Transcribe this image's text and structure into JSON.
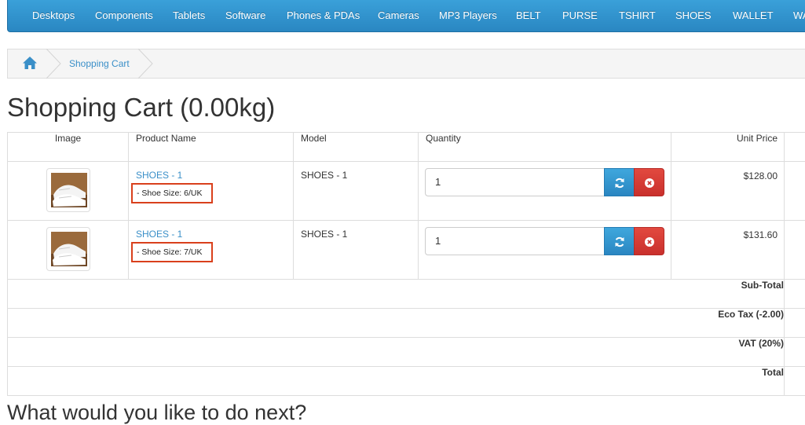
{
  "nav": {
    "items": [
      "Desktops",
      "Components",
      "Tablets",
      "Software",
      "Phones & PDAs",
      "Cameras",
      "MP3 Players",
      "BELT",
      "PURSE",
      "TSHIRT",
      "SHOES",
      "WALLET",
      "WA"
    ]
  },
  "breadcrumb": {
    "home_icon": "home-icon",
    "current": "Shopping Cart"
  },
  "page": {
    "title": "Shopping Cart (0.00kg)",
    "next_heading": "What would you like to do next?"
  },
  "table": {
    "headers": {
      "image": "Image",
      "name": "Product Name",
      "model": "Model",
      "quantity": "Quantity",
      "unit_price": "Unit Price"
    },
    "rows": [
      {
        "name": "SHOES - 1",
        "option": "- Shoe Size: 6/UK",
        "model": "SHOES - 1",
        "quantity": "1",
        "unit_price": "$128.00"
      },
      {
        "name": "SHOES - 1",
        "option": "- Shoe Size: 7/UK",
        "model": "SHOES - 1",
        "quantity": "1",
        "unit_price": "$131.60"
      }
    ],
    "totals": [
      {
        "label": "Sub-Total"
      },
      {
        "label": "Eco Tax (-2.00)"
      },
      {
        "label": "VAT (20%)"
      },
      {
        "label": "Total"
      }
    ]
  },
  "colors": {
    "nav_blue": "#2a87c2",
    "link_blue": "#3a8fc8",
    "update_button": "#2a86c1",
    "remove_button": "#c9302c",
    "option_highlight": "#d9401c"
  },
  "icons": {
    "update": "refresh-icon",
    "remove": "close-circle-icon"
  }
}
